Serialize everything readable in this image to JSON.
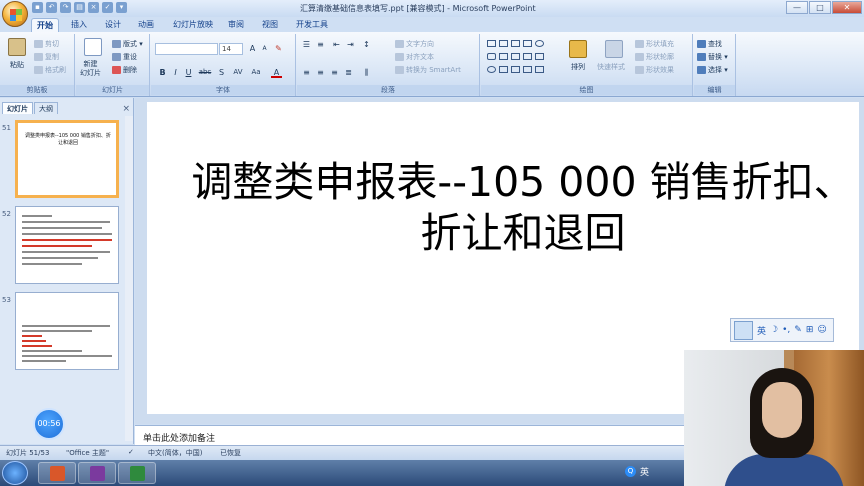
{
  "window": {
    "title": "汇算清缴基础信息表填写.ppt [兼容模式] - Microsoft PowerPoint",
    "controls": [
      "—",
      "□",
      "✕"
    ]
  },
  "tabs": [
    {
      "label": "开始",
      "active": true
    },
    {
      "label": "插入"
    },
    {
      "label": "设计"
    },
    {
      "label": "动画"
    },
    {
      "label": "幻灯片放映"
    },
    {
      "label": "审阅"
    },
    {
      "label": "视图"
    },
    {
      "label": "开发工具"
    }
  ],
  "ribbon": {
    "clipboard": {
      "label": "剪贴板",
      "paste": "粘贴",
      "cut": "剪切",
      "copy": "复制",
      "format_painter": "格式刷"
    },
    "slides": {
      "label": "幻灯片",
      "new_slide": "新建\n幻灯片",
      "layout": "版式",
      "reset": "重设",
      "delete": "删除"
    },
    "font": {
      "label": "字体",
      "font_name": "",
      "font_size": "14",
      "buttons": [
        "B",
        "I",
        "U",
        "abc",
        "S",
        "AV",
        "Aa",
        "A"
      ],
      "grow": "A",
      "shrink": "A"
    },
    "paragraph": {
      "label": "段落",
      "text_direction": "文字方向",
      "align_text": "对齐文本",
      "smartart": "转换为 SmartArt"
    },
    "drawing": {
      "label": "绘图",
      "arrange": "排列",
      "quick_styles": "快速样式",
      "shape_fill": "形状填充",
      "shape_outline": "形状轮廓",
      "shape_effects": "形状效果"
    },
    "editing": {
      "label": "编辑",
      "find": "查找",
      "replace": "替换",
      "select": "选择"
    }
  },
  "left_pane": {
    "tabs": [
      "幻灯片",
      "大纲"
    ],
    "close": "×",
    "thumbnails": [
      {
        "num": "51",
        "text": "调整类申报表--105 000 销售折扣、折让和退回",
        "selected": true
      },
      {
        "num": "52",
        "text": ""
      },
      {
        "num": "53",
        "text": ""
      }
    ],
    "timer": "00:56"
  },
  "slide": {
    "title": "调整类申报表--105 000 销售折扣、折让和退回"
  },
  "ime_bar": {
    "items": [
      "英",
      "☽",
      "•,",
      "✎",
      "⊞",
      "☺"
    ]
  },
  "notes": {
    "placeholder": "单击此处添加备注"
  },
  "status_bar": {
    "slide_count": "幻灯片 51/53",
    "theme": "\"Office 主题\"",
    "language": "中文(简体，中国)",
    "recovered": "已恢复"
  },
  "taskbar": {
    "tray_lang": "英"
  },
  "colors": {
    "ribbon_bg": "#dbe7f6",
    "selected_thumb": "#f6b14e",
    "taskbar": "#2b4a78"
  }
}
